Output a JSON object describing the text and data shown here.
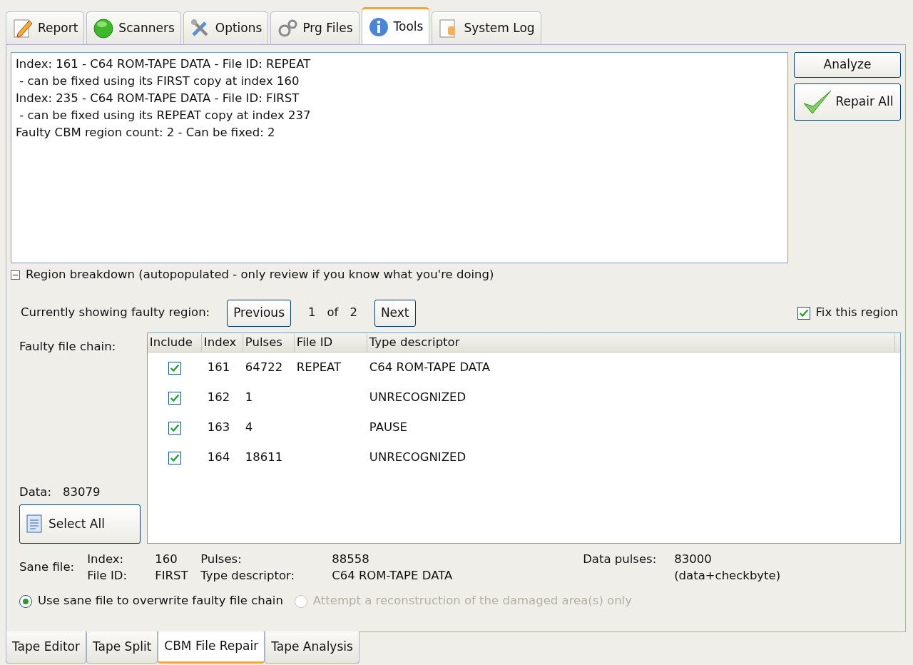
{
  "top_tabs": [
    {
      "label": "Report",
      "selected": false
    },
    {
      "label": "Scanners",
      "selected": false
    },
    {
      "label": "Options",
      "selected": false
    },
    {
      "label": "Prg Files",
      "selected": false
    },
    {
      "label": "Tools",
      "selected": true
    },
    {
      "label": "System Log",
      "selected": false
    }
  ],
  "log_lines": [
    "Index: 161 - C64 ROM-TAPE DATA - File ID: REPEAT",
    " - can be fixed using its FIRST copy at index 160",
    "Index: 235 - C64 ROM-TAPE DATA - File ID: FIRST",
    " - can be fixed using its REPEAT copy at index 237",
    "Faulty CBM region count: 2 - Can be fixed: 2"
  ],
  "side_buttons": [
    {
      "label": "Analyze",
      "kind": "plain"
    },
    {
      "label": "Repair All",
      "kind": "check"
    }
  ],
  "region_breakdown": {
    "label": "Region breakdown (autopopulated - only review if you know what you're doing)",
    "expanded": true
  },
  "navigator": {
    "label": "Currently showing faulty region:",
    "previous": "Previous",
    "current": "1",
    "of": "of",
    "total": "2",
    "next": "Next"
  },
  "fix_region": {
    "label": "Fix this region",
    "checked": true
  },
  "chain_label": "Faulty file chain:",
  "data_label": "Data:",
  "data_value": "83079",
  "select_all": "Select All",
  "table": {
    "columns": [
      "Include",
      "Index",
      "Pulses",
      "File ID",
      "Type descriptor"
    ],
    "rows": [
      {
        "include": true,
        "index": "161",
        "pulses": "64722",
        "file_id": "REPEAT",
        "type": "C64 ROM-TAPE DATA"
      },
      {
        "include": true,
        "index": "162",
        "pulses": "1",
        "type": "UNRECOGNIZED"
      },
      {
        "include": true,
        "index": "163",
        "pulses": "4",
        "type": "PAUSE"
      },
      {
        "include": true,
        "index": "164",
        "pulses": "18611",
        "type": "UNRECOGNIZED"
      }
    ]
  },
  "sane_file": {
    "label": "Sane file:",
    "fields": [
      {
        "label": "Index:",
        "value": "160"
      },
      {
        "label": "Pulses:",
        "value": "88558"
      },
      {
        "label": "Data pulses:",
        "value": "83000"
      },
      {
        "label": "File ID:",
        "value": "FIRST"
      },
      {
        "label": "Type descriptor:",
        "value": "C64 ROM-TAPE DATA"
      },
      {
        "value": "(data+checkbyte)"
      }
    ]
  },
  "options": [
    {
      "label": "Use sane file to overwrite faulty file chain",
      "selected": true,
      "disabled": false
    },
    {
      "label": "Attempt a reconstruction of the damaged area(s) only",
      "selected": false,
      "disabled": true
    }
  ],
  "bottom_tabs": [
    {
      "label": "Tape Editor",
      "selected": false
    },
    {
      "label": "Tape Split",
      "selected": false
    },
    {
      "label": "CBM File Repair",
      "selected": true
    },
    {
      "label": "Tape Analysis",
      "selected": false
    }
  ]
}
